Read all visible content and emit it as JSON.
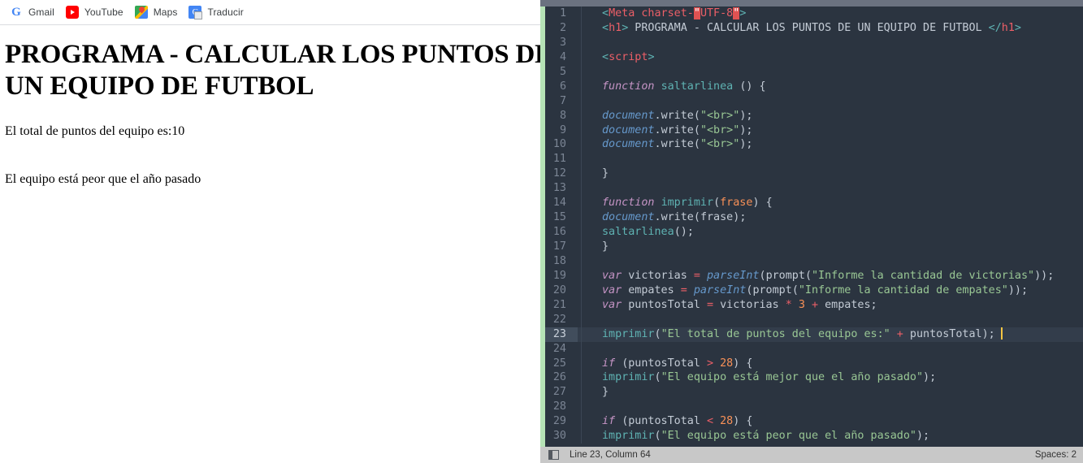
{
  "browser": {
    "bookmarks": [
      {
        "label": "Gmail",
        "icon": "google-icon"
      },
      {
        "label": "YouTube",
        "icon": "youtube-icon"
      },
      {
        "label": "Maps",
        "icon": "maps-icon"
      },
      {
        "label": "Traducir",
        "icon": "translate-icon"
      }
    ],
    "page": {
      "heading_line1": "PROGRAMA - CALCULAR LOS PUNTOS DE",
      "heading_line2": "UN EQUIPO DE FUTBOL",
      "output_line1": "El total de puntos del equipo es:10",
      "output_line2": "El equipo está peor que el año pasado"
    }
  },
  "editor": {
    "theme": {
      "background": "#2b3440",
      "active_line": "#333d4b",
      "gutter_text": "#7b8594",
      "tag": "#ec5f67",
      "bracket": "#5fb3b3",
      "keyword": "#c594c5",
      "function": "#6699cc",
      "string": "#99c794",
      "number": "#f99157",
      "operator": "#ec5f67",
      "error_highlight": "#e05252",
      "caret": "#f5c542",
      "modified_rail": "#b6e3b6"
    },
    "active_line": 23,
    "lines": [
      {
        "n": 1,
        "tokens": [
          {
            "t": "punct",
            "v": "<"
          },
          {
            "t": "tag",
            "v": "Meta"
          },
          {
            "t": "text",
            "v": " "
          },
          {
            "t": "tag",
            "v": "charset-"
          },
          {
            "t": "err",
            "v": "\""
          },
          {
            "t": "tag",
            "v": "UTF-8"
          },
          {
            "t": "err",
            "v": "\""
          },
          {
            "t": "punct",
            "v": ">"
          }
        ]
      },
      {
        "n": 2,
        "tokens": [
          {
            "t": "punct",
            "v": "<"
          },
          {
            "t": "tag",
            "v": "h1"
          },
          {
            "t": "punct",
            "v": ">"
          },
          {
            "t": "text",
            "v": " PROGRAMA - CALCULAR LOS PUNTOS DE UN EQUIPO DE FUTBOL "
          },
          {
            "t": "punct",
            "v": "</"
          },
          {
            "t": "tag",
            "v": "h1"
          },
          {
            "t": "punct",
            "v": ">"
          }
        ]
      },
      {
        "n": 3,
        "tokens": []
      },
      {
        "n": 4,
        "tokens": [
          {
            "t": "punct",
            "v": "<"
          },
          {
            "t": "tag",
            "v": "script"
          },
          {
            "t": "punct",
            "v": ">"
          }
        ]
      },
      {
        "n": 5,
        "tokens": []
      },
      {
        "n": 6,
        "tokens": [
          {
            "t": "text",
            "v": "  "
          },
          {
            "t": "kw",
            "v": "function"
          },
          {
            "t": "text",
            "v": " "
          },
          {
            "t": "fname",
            "v": "saltarlinea"
          },
          {
            "t": "text",
            "v": " "
          },
          {
            "t": "paren",
            "v": "("
          },
          {
            "t": "paren",
            "v": ")"
          },
          {
            "t": "text",
            "v": " "
          },
          {
            "t": "paren",
            "v": "{"
          }
        ]
      },
      {
        "n": 7,
        "tokens": []
      },
      {
        "n": 8,
        "tokens": [
          {
            "t": "text",
            "v": "  "
          },
          {
            "t": "fn",
            "v": "document"
          },
          {
            "t": "text",
            "v": "."
          },
          {
            "t": "call",
            "v": "write"
          },
          {
            "t": "paren",
            "v": "("
          },
          {
            "t": "str",
            "v": "\"<br>\""
          },
          {
            "t": "paren",
            "v": ")"
          },
          {
            "t": "text",
            "v": ";"
          }
        ]
      },
      {
        "n": 9,
        "tokens": [
          {
            "t": "text",
            "v": "  "
          },
          {
            "t": "fn",
            "v": "document"
          },
          {
            "t": "text",
            "v": "."
          },
          {
            "t": "call",
            "v": "write"
          },
          {
            "t": "paren",
            "v": "("
          },
          {
            "t": "str",
            "v": "\"<br>\""
          },
          {
            "t": "paren",
            "v": ")"
          },
          {
            "t": "text",
            "v": ";"
          }
        ]
      },
      {
        "n": 10,
        "tokens": [
          {
            "t": "text",
            "v": "  "
          },
          {
            "t": "fn",
            "v": "document"
          },
          {
            "t": "text",
            "v": "."
          },
          {
            "t": "call",
            "v": "write"
          },
          {
            "t": "paren",
            "v": "("
          },
          {
            "t": "str",
            "v": "\"<br>\""
          },
          {
            "t": "paren",
            "v": ")"
          },
          {
            "t": "text",
            "v": ";"
          }
        ]
      },
      {
        "n": 11,
        "tokens": []
      },
      {
        "n": 12,
        "tokens": [
          {
            "t": "text",
            "v": "  "
          },
          {
            "t": "paren",
            "v": "}"
          }
        ]
      },
      {
        "n": 13,
        "tokens": []
      },
      {
        "n": 14,
        "tokens": [
          {
            "t": "text",
            "v": "  "
          },
          {
            "t": "kw",
            "v": "function"
          },
          {
            "t": "text",
            "v": " "
          },
          {
            "t": "fname",
            "v": "imprimir"
          },
          {
            "t": "paren",
            "v": "("
          },
          {
            "t": "param",
            "v": "frase"
          },
          {
            "t": "paren",
            "v": ")"
          },
          {
            "t": "text",
            "v": " "
          },
          {
            "t": "paren",
            "v": "{"
          }
        ]
      },
      {
        "n": 15,
        "tokens": [
          {
            "t": "text",
            "v": "  "
          },
          {
            "t": "fn",
            "v": "document"
          },
          {
            "t": "text",
            "v": "."
          },
          {
            "t": "call",
            "v": "write"
          },
          {
            "t": "paren",
            "v": "("
          },
          {
            "t": "text",
            "v": "frase"
          },
          {
            "t": "paren",
            "v": ")"
          },
          {
            "t": "text",
            "v": ";"
          }
        ]
      },
      {
        "n": 16,
        "tokens": [
          {
            "t": "text",
            "v": "  "
          },
          {
            "t": "fname",
            "v": "saltarlinea"
          },
          {
            "t": "paren",
            "v": "("
          },
          {
            "t": "paren",
            "v": ")"
          },
          {
            "t": "text",
            "v": ";"
          }
        ]
      },
      {
        "n": 17,
        "tokens": [
          {
            "t": "text",
            "v": "  "
          },
          {
            "t": "paren",
            "v": "}"
          }
        ]
      },
      {
        "n": 18,
        "tokens": []
      },
      {
        "n": 19,
        "tokens": [
          {
            "t": "text",
            "v": "  "
          },
          {
            "t": "kw",
            "v": "var"
          },
          {
            "t": "text",
            "v": " victorias "
          },
          {
            "t": "op",
            "v": "="
          },
          {
            "t": "text",
            "v": " "
          },
          {
            "t": "fn",
            "v": "parseInt"
          },
          {
            "t": "paren",
            "v": "("
          },
          {
            "t": "call",
            "v": "prompt"
          },
          {
            "t": "paren",
            "v": "("
          },
          {
            "t": "str",
            "v": "\"Informe la cantidad de victorias\""
          },
          {
            "t": "paren",
            "v": "))"
          },
          {
            "t": "text",
            "v": ";"
          }
        ]
      },
      {
        "n": 20,
        "tokens": [
          {
            "t": "text",
            "v": "  "
          },
          {
            "t": "kw",
            "v": "var"
          },
          {
            "t": "text",
            "v": " empates "
          },
          {
            "t": "op",
            "v": "="
          },
          {
            "t": "text",
            "v": " "
          },
          {
            "t": "fn",
            "v": "parseInt"
          },
          {
            "t": "paren",
            "v": "("
          },
          {
            "t": "call",
            "v": "prompt"
          },
          {
            "t": "paren",
            "v": "("
          },
          {
            "t": "str",
            "v": "\"Informe la cantidad de empates\""
          },
          {
            "t": "paren",
            "v": "))"
          },
          {
            "t": "text",
            "v": ";"
          }
        ]
      },
      {
        "n": 21,
        "tokens": [
          {
            "t": "text",
            "v": "  "
          },
          {
            "t": "kw",
            "v": "var"
          },
          {
            "t": "text",
            "v": " puntosTotal "
          },
          {
            "t": "op",
            "v": "="
          },
          {
            "t": "text",
            "v": " victorias "
          },
          {
            "t": "op",
            "v": "*"
          },
          {
            "t": "text",
            "v": " "
          },
          {
            "t": "num",
            "v": "3"
          },
          {
            "t": "text",
            "v": " "
          },
          {
            "t": "op",
            "v": "+"
          },
          {
            "t": "text",
            "v": " empates;"
          }
        ]
      },
      {
        "n": 22,
        "tokens": []
      },
      {
        "n": 23,
        "tokens": [
          {
            "t": "text",
            "v": "  "
          },
          {
            "t": "fname",
            "v": "imprimir"
          },
          {
            "t": "paren",
            "v": "("
          },
          {
            "t": "str",
            "v": "\"El total de puntos del equipo es:\""
          },
          {
            "t": "text",
            "v": " "
          },
          {
            "t": "op",
            "v": "+"
          },
          {
            "t": "text",
            "v": " puntosTotal"
          },
          {
            "t": "paren",
            "v": ")"
          },
          {
            "t": "text",
            "v": ";"
          },
          {
            "t": "caret",
            "v": ""
          }
        ]
      },
      {
        "n": 24,
        "tokens": []
      },
      {
        "n": 25,
        "tokens": [
          {
            "t": "text",
            "v": "  "
          },
          {
            "t": "kw2",
            "v": "if"
          },
          {
            "t": "text",
            "v": " "
          },
          {
            "t": "paren",
            "v": "("
          },
          {
            "t": "text",
            "v": "puntosTotal "
          },
          {
            "t": "op",
            "v": ">"
          },
          {
            "t": "text",
            "v": " "
          },
          {
            "t": "num",
            "v": "28"
          },
          {
            "t": "paren",
            "v": ")"
          },
          {
            "t": "text",
            "v": " "
          },
          {
            "t": "paren",
            "v": "{"
          }
        ]
      },
      {
        "n": 26,
        "tokens": [
          {
            "t": "text",
            "v": "  "
          },
          {
            "t": "fname",
            "v": "imprimir"
          },
          {
            "t": "paren",
            "v": "("
          },
          {
            "t": "str",
            "v": "\"El equipo está mejor que el año pasado\""
          },
          {
            "t": "paren",
            "v": ")"
          },
          {
            "t": "text",
            "v": ";"
          }
        ]
      },
      {
        "n": 27,
        "tokens": [
          {
            "t": "text",
            "v": "  "
          },
          {
            "t": "paren",
            "v": "}"
          }
        ]
      },
      {
        "n": 28,
        "tokens": []
      },
      {
        "n": 29,
        "tokens": [
          {
            "t": "text",
            "v": "  "
          },
          {
            "t": "kw2",
            "v": "if"
          },
          {
            "t": "text",
            "v": " "
          },
          {
            "t": "paren",
            "v": "("
          },
          {
            "t": "text",
            "v": "puntosTotal "
          },
          {
            "t": "op",
            "v": "<"
          },
          {
            "t": "text",
            "v": " "
          },
          {
            "t": "num",
            "v": "28"
          },
          {
            "t": "paren",
            "v": ")"
          },
          {
            "t": "text",
            "v": " "
          },
          {
            "t": "paren",
            "v": "{"
          }
        ]
      },
      {
        "n": 30,
        "tokens": [
          {
            "t": "text",
            "v": "  "
          },
          {
            "t": "fname",
            "v": "imprimir"
          },
          {
            "t": "paren",
            "v": "("
          },
          {
            "t": "str",
            "v": "\"El equipo está peor que el año pasado\""
          },
          {
            "t": "paren",
            "v": ")"
          },
          {
            "t": "text",
            "v": ";"
          }
        ]
      }
    ],
    "status_bar": {
      "cursor_position": "Line 23, Column 64",
      "indentation": "Spaces: 2"
    }
  }
}
